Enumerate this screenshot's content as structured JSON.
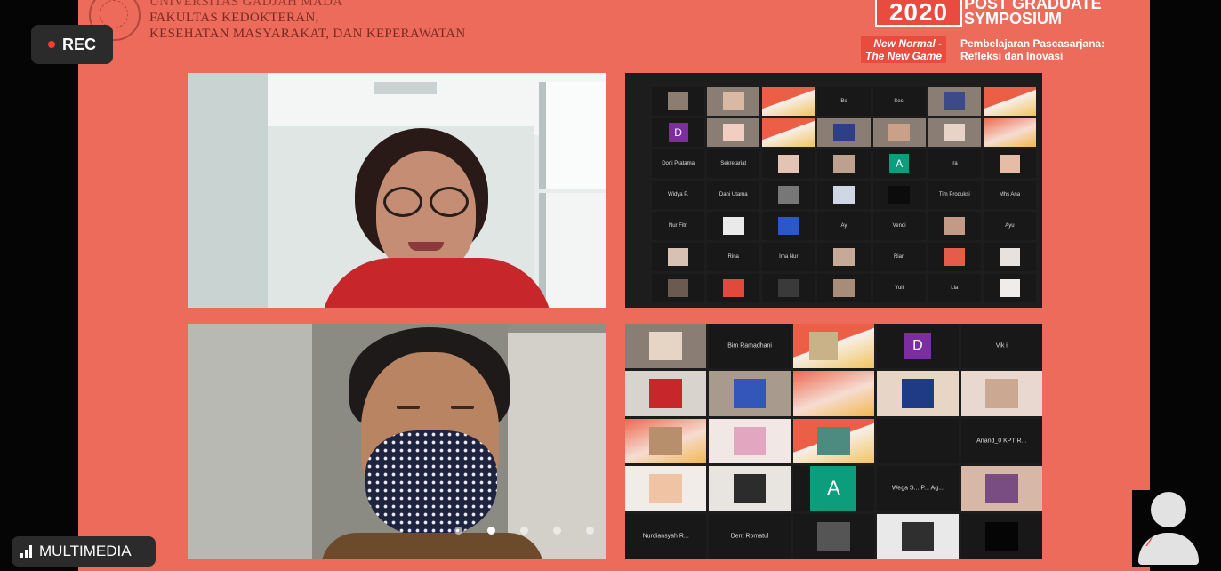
{
  "header": {
    "university": "UNIVERSITAS GADJAH MADA",
    "faculty_line1": "FAKULTAS KEDOKTERAN,",
    "faculty_line2": "KESEHATAN MASYARAKAT, DAN KEPERAWATAN",
    "year": "2020",
    "symposium_line1": "POST GRADUATE",
    "symposium_line2": "SYMPOSIUM",
    "tagline1_line1": "New Normal -",
    "tagline1_line2": "The New Game",
    "tagline2_line1": "Pembelajaran Pascasarjana:",
    "tagline2_line2": "Refleksi dan Inovasi"
  },
  "recording": {
    "label": "REC"
  },
  "network": {
    "label": "MULTIMEDIA"
  },
  "gallery_top": {
    "initials": [
      "D",
      "A"
    ],
    "names": [
      "Bo",
      "Sesi",
      "Doni Pratama",
      "Sekretariat",
      "Ira",
      "Widya P.",
      "Dani Utama",
      "Tim Produksi",
      "Mhs Ana",
      "Nur Fitri",
      "Ay",
      "Vendi",
      "Ayu",
      "Rina",
      "Ima Nur",
      "Rian",
      "Yuli",
      "Lia"
    ]
  },
  "gallery_bottom": {
    "initials": [
      "D",
      "A"
    ],
    "names": [
      "Bim Ramadhani",
      "Vik i",
      "Anand_0 KPT R...",
      "Wega S... P... Ag...",
      "Nurdiansyah R...",
      "Dent Romatul"
    ]
  },
  "colors": {
    "stage_bg": "#ec6b5b",
    "rec_dot": "#ff3b30",
    "avatar_purple": "#7b2ea0",
    "avatar_green": "#0c9e7c"
  }
}
